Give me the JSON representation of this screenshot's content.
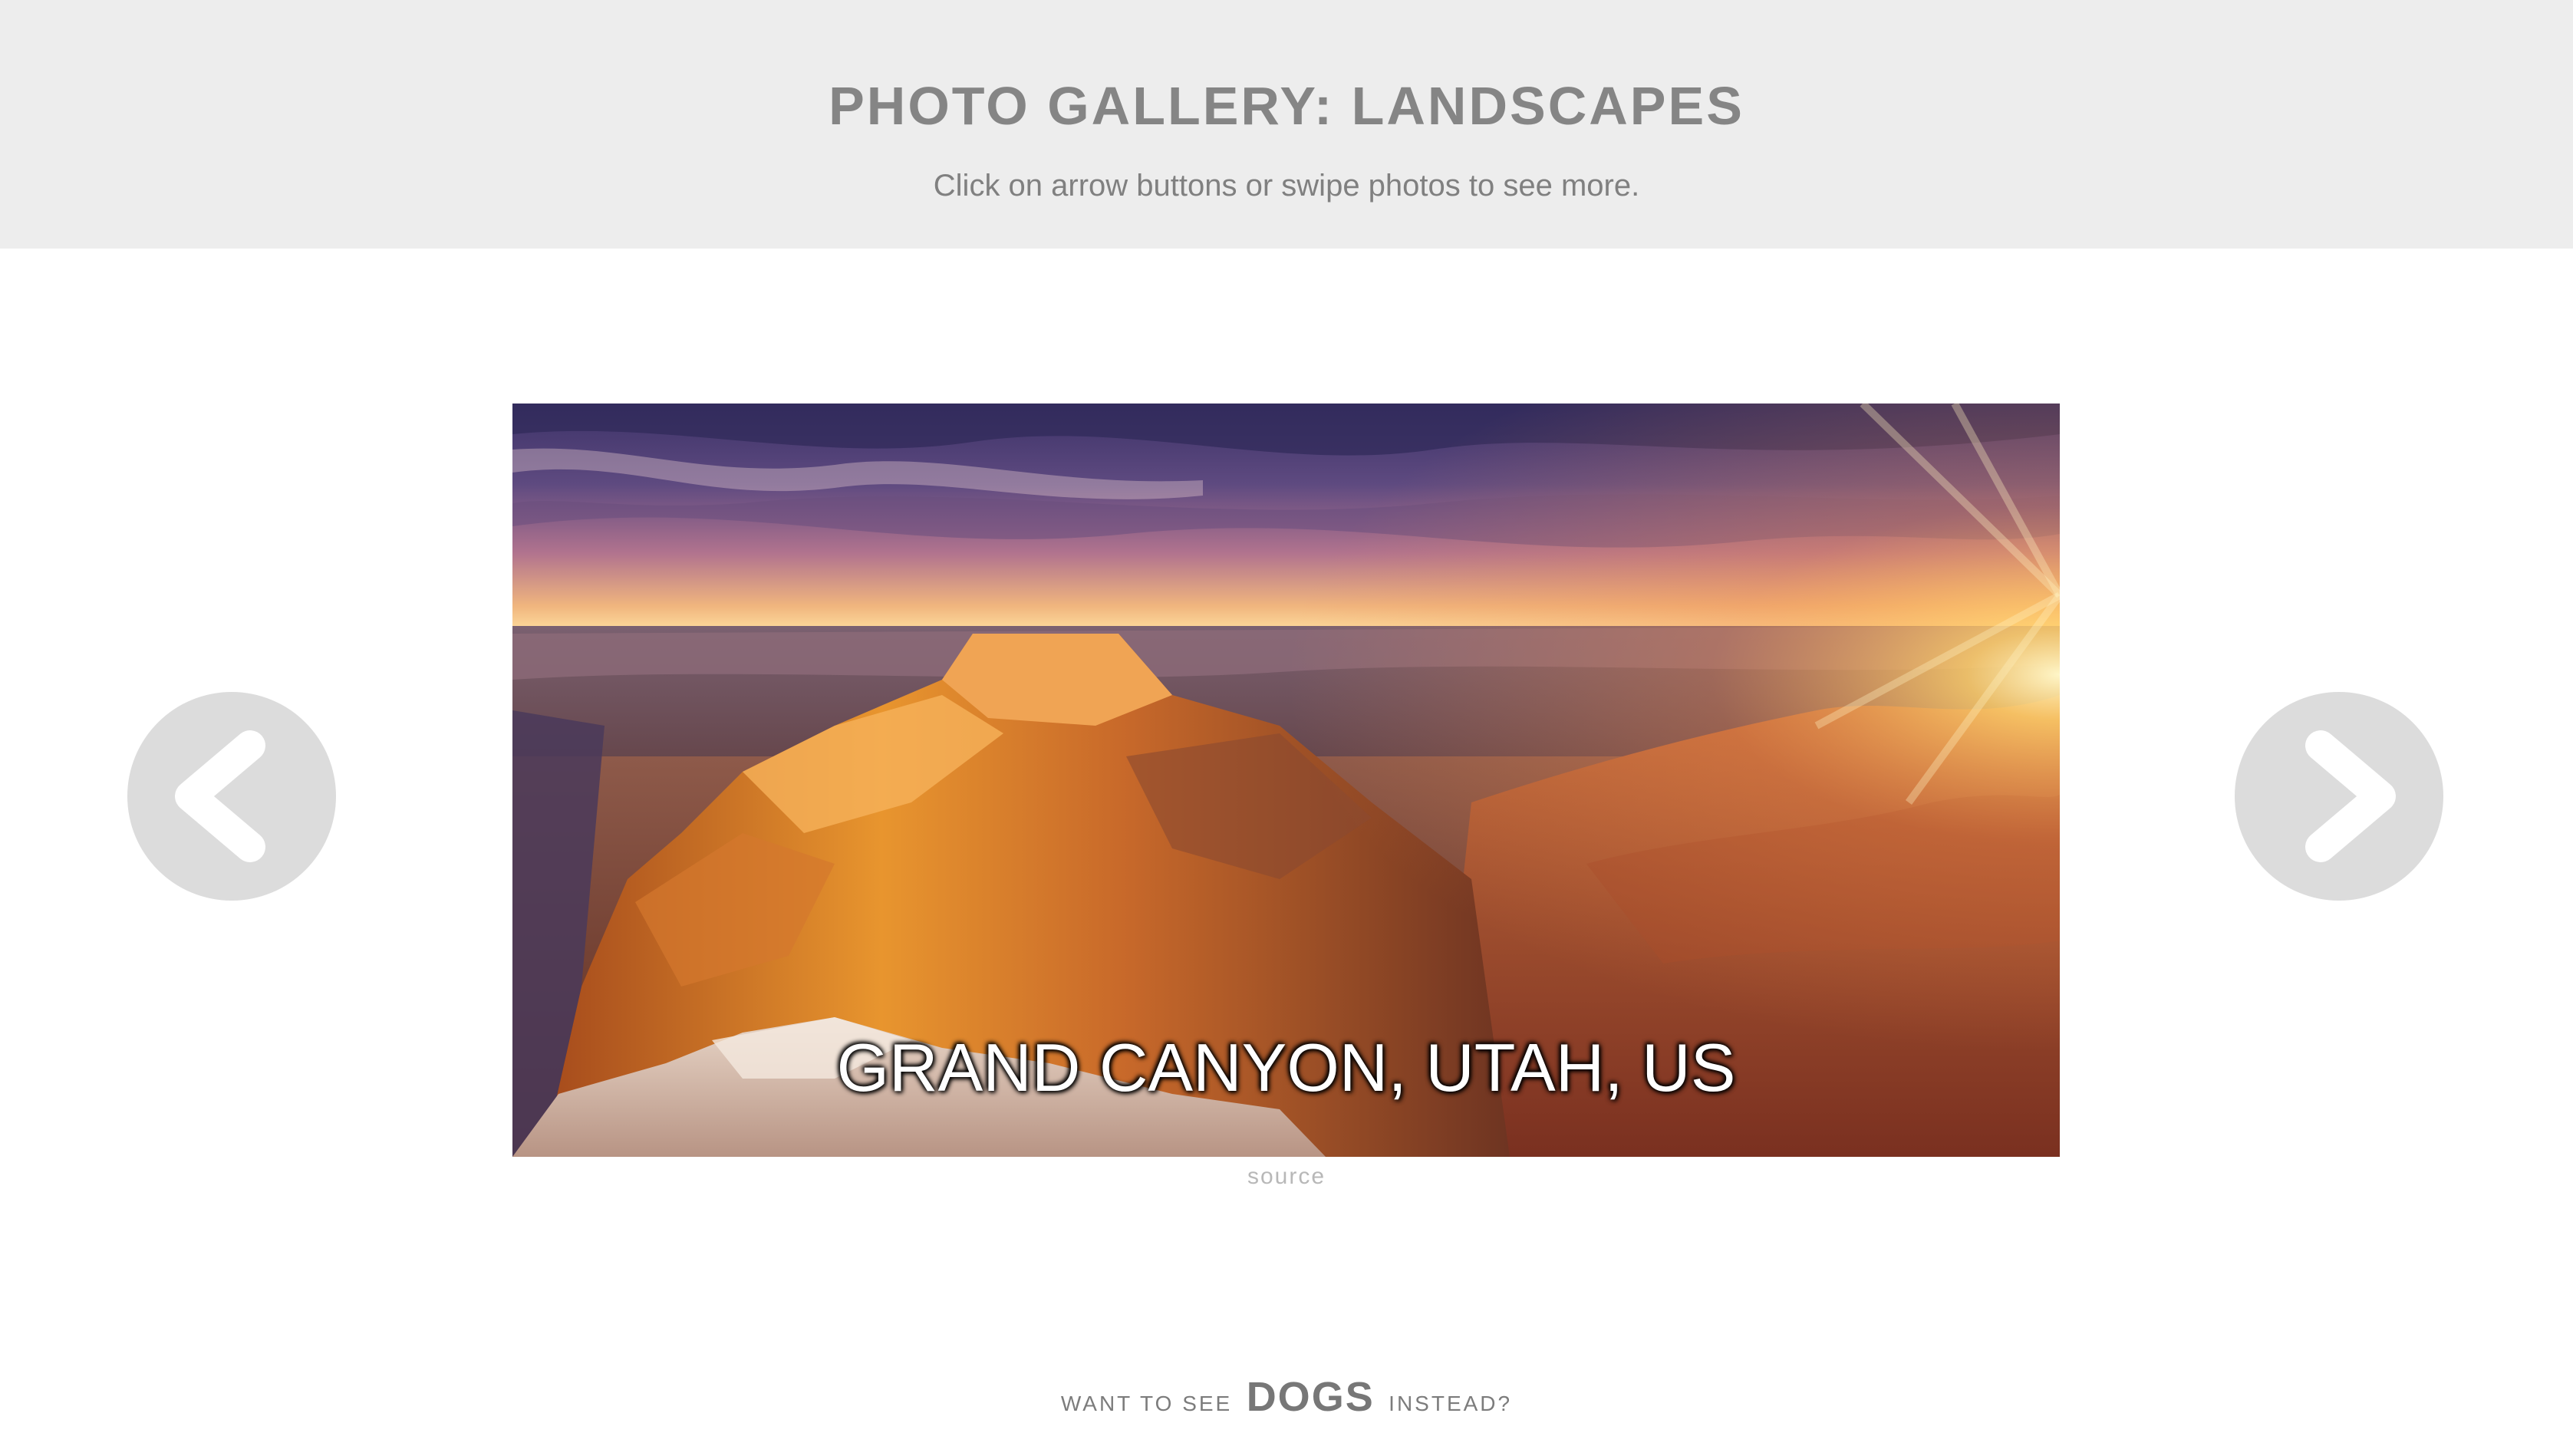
{
  "header": {
    "title": "PHOTO GALLERY: LANDSCAPES",
    "subtitle": "Click on arrow buttons or swipe photos to see more."
  },
  "gallery": {
    "caption": "GRAND CANYON, UTAH, US",
    "source_link": "source",
    "prev_icon": "chevron-left-icon",
    "next_icon": "chevron-right-icon"
  },
  "footer": {
    "prefix": "WANT TO SEE",
    "link": "DOGS",
    "suffix": "INSTEAD?"
  },
  "colors": {
    "header_bg": "#ededed",
    "arrow_bg": "#dcdcdc",
    "text_gray": "#858585"
  }
}
